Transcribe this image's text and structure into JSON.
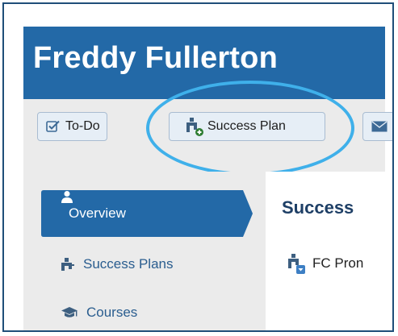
{
  "header": {
    "title": "Freddy Fullerton"
  },
  "toolbar": {
    "todo_label": "To-Do",
    "success_plan_label": "Success Plan"
  },
  "sidebar": {
    "items": [
      {
        "label": "Overview",
        "icon": "user-icon",
        "active": true
      },
      {
        "label": "Success Plans",
        "icon": "org-chart-icon",
        "active": false
      },
      {
        "label": "Courses",
        "icon": "graduation-cap-icon",
        "active": false
      }
    ]
  },
  "content": {
    "title": "Success",
    "items": [
      {
        "label": "FC Pron"
      }
    ]
  },
  "colors": {
    "header_bg": "#2369a7",
    "active_nav_bg": "#2369a7",
    "highlight": "#3fb0ea",
    "panel_bg": "#ebebeb",
    "nav_text": "#2a5d8f"
  }
}
